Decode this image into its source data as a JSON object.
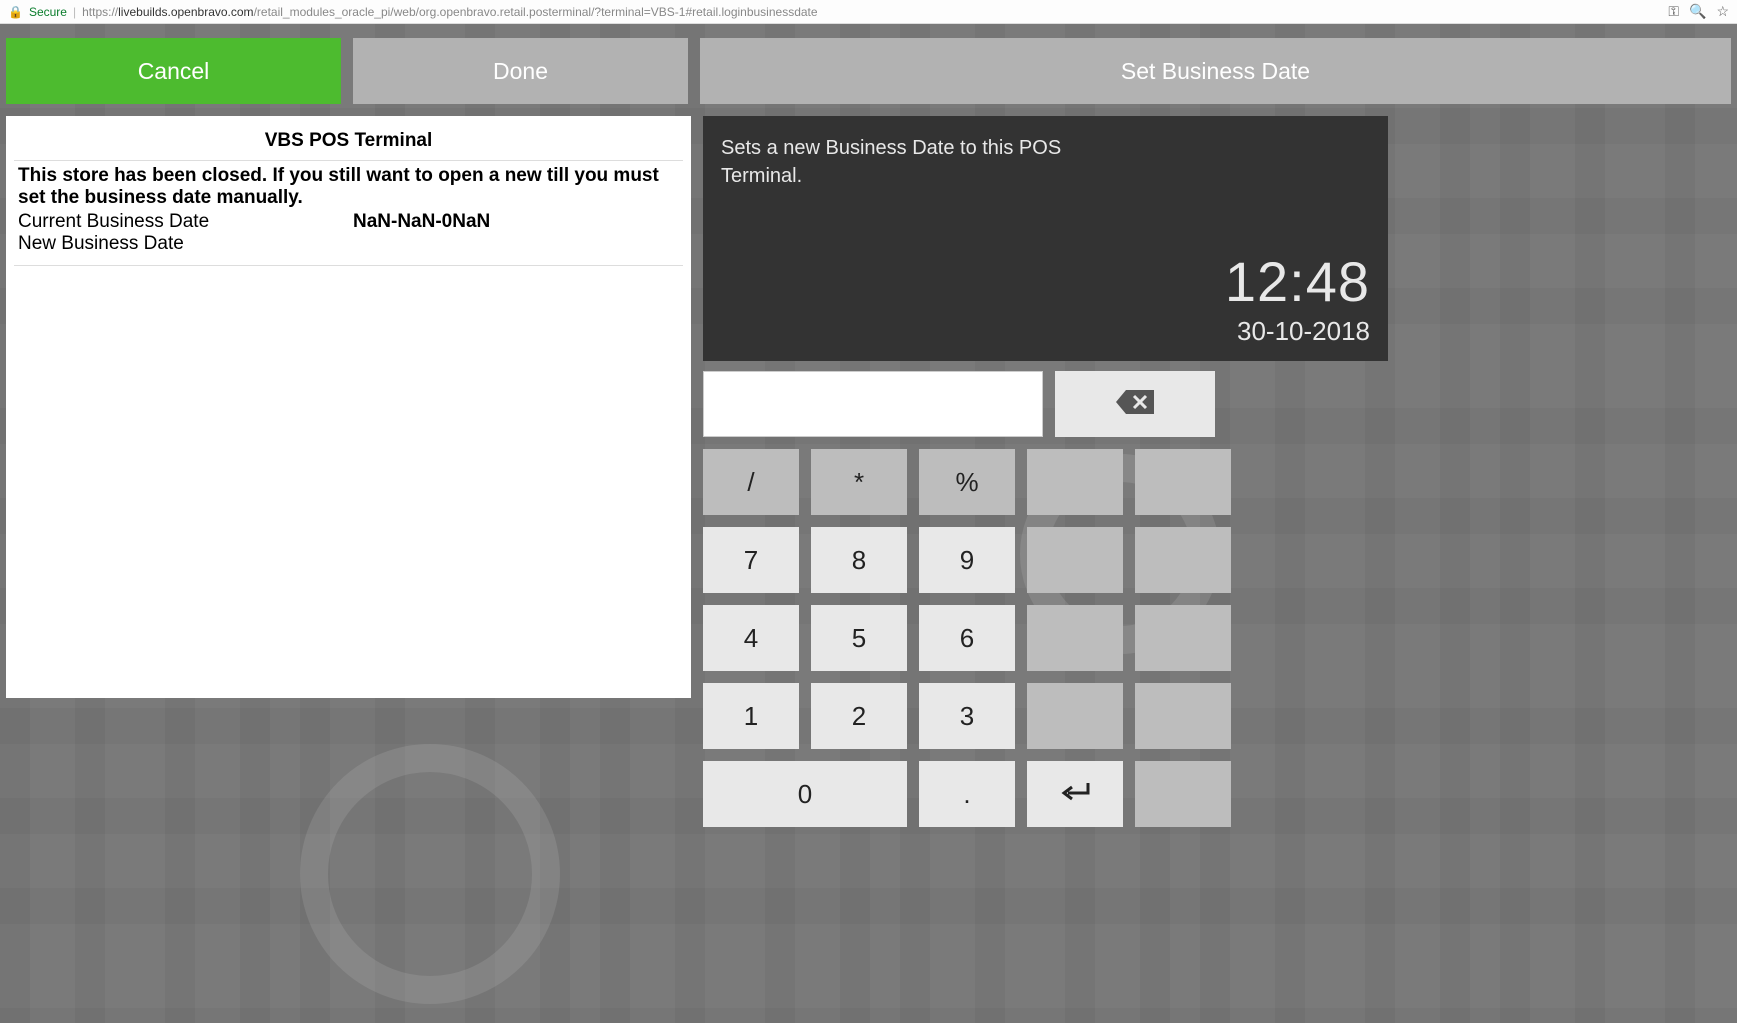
{
  "browser": {
    "secure_label": "Secure",
    "url_proto": "https://",
    "url_host": "livebuilds.openbravo.com",
    "url_path": "/retail_modules_oracle_pi/web/org.openbravo.retail.posterminal/?terminal=VBS-1#retail.loginbusinessdate"
  },
  "top": {
    "cancel": "Cancel",
    "done": "Done",
    "set_business_date": "Set Business Date"
  },
  "left": {
    "title": "VBS POS Terminal",
    "message": "This store has been closed. If you still want to open a new till you must set the business date manually.",
    "current_label": "Current Business Date",
    "current_value": "NaN-NaN-0NaN",
    "new_label": "New Business Date",
    "new_value": ""
  },
  "right": {
    "description": "Sets a new Business Date to this POS Terminal.",
    "time": "12:48",
    "date": "30-10-2018"
  },
  "keypad": {
    "display_value": "",
    "rows": [
      [
        "/",
        "*",
        "%",
        "",
        ""
      ],
      [
        "7",
        "8",
        "9",
        "",
        ""
      ],
      [
        "4",
        "5",
        "6",
        "",
        ""
      ],
      [
        "1",
        "2",
        "3",
        "",
        ""
      ]
    ],
    "last_row": {
      "zero": "0",
      "dot": ".",
      "enter_icon": "enter"
    }
  }
}
